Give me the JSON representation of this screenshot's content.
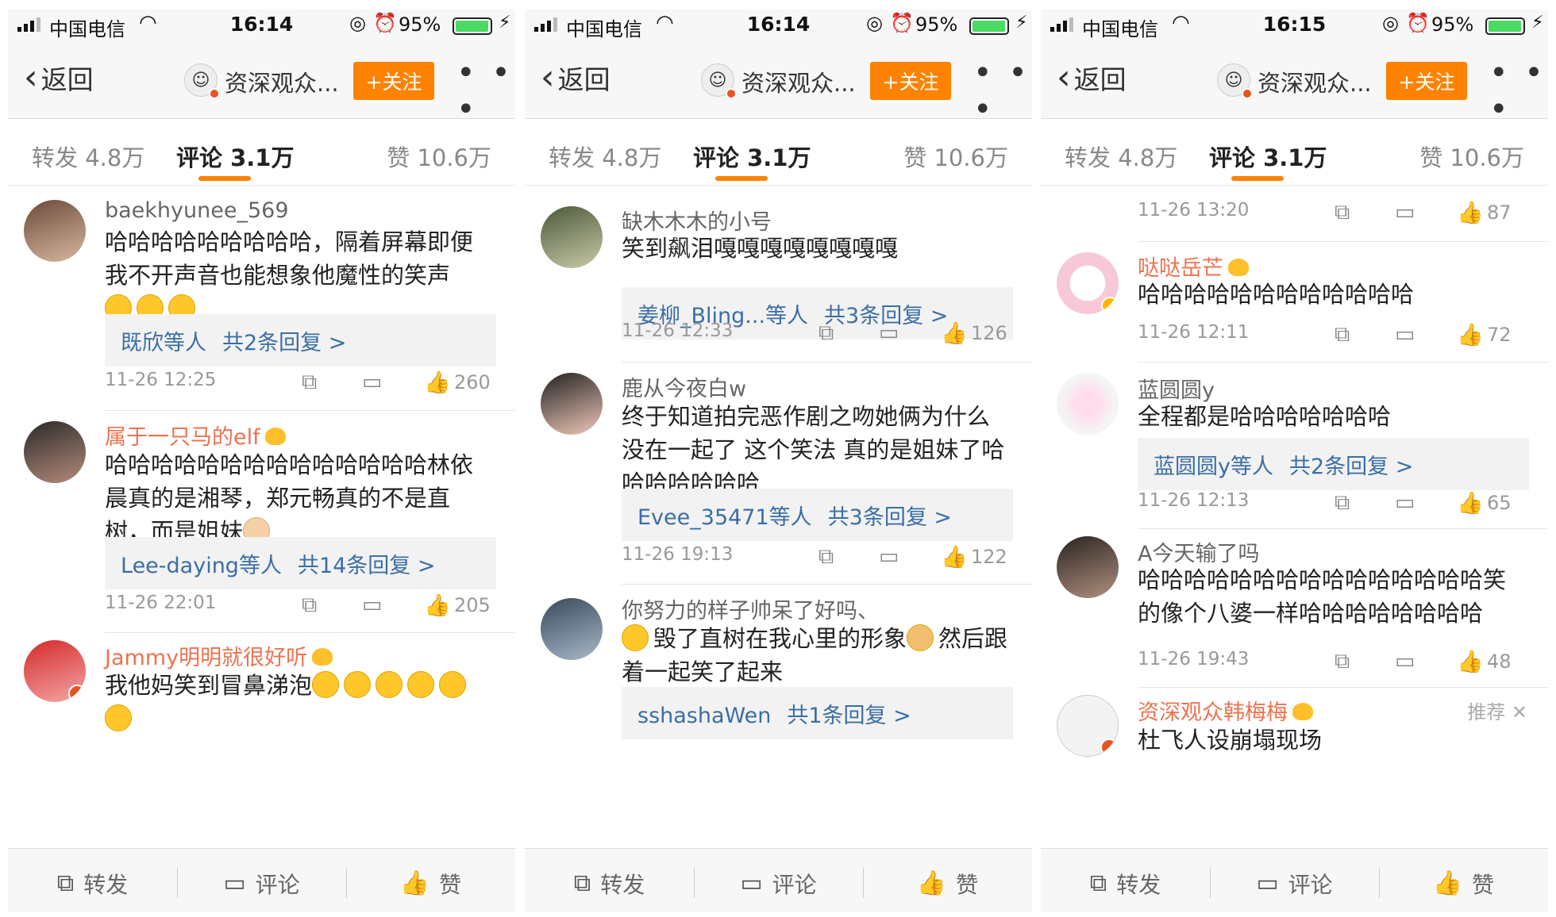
{
  "common": {
    "carrier": "中国电信",
    "battery": "95%",
    "back_label": "返回",
    "account_name": "资深观众...",
    "follow_label": "+关注",
    "more_label": "• • •",
    "tab_repost": "转发 4.8万",
    "tab_comment": "评论 3.1万",
    "tab_like": "赞 10.6万",
    "bottom_repost": "转发",
    "bottom_comment": "评论",
    "bottom_like": "赞",
    "colors": {
      "accent": "#ff8200",
      "link": "#3b6ea5",
      "vip_name": "#eb7350"
    }
  },
  "screens": [
    {
      "time": "16:14",
      "comments": [
        {
          "user": "baekhyunee_569",
          "text": "哈哈哈哈哈哈哈哈哈，隔着屏幕即便我不开声音也能想象他魔性的笑声",
          "reply_users": "既欣等人",
          "reply_count": "共2条回复 >",
          "date": "11-26 12:25",
          "likes": "260"
        },
        {
          "user": "属于一只马的elf",
          "text": "哈哈哈哈哈哈哈哈哈哈哈哈哈哈林依晨真的是湘琴，郑元畅真的不是直树，而是姐妹",
          "reply_users": "Lee-daying等人",
          "reply_count": "共14条回复 >",
          "date": "11-26 22:01",
          "likes": "205"
        },
        {
          "user": "Jammy明明就很好听",
          "text": "我他妈笑到冒鼻涕泡"
        }
      ]
    },
    {
      "time": "16:14",
      "comments": [
        {
          "user": "缺木木木的小号",
          "text": "笑到飙泪嘎嘎嘎嘎嘎嘎嘎嘎",
          "reply_users": "姜柳_Bling...等人",
          "reply_count": "共3条回复 >",
          "date": "11-26 12:33",
          "likes": "126"
        },
        {
          "user": "鹿从今夜白w",
          "text": "终于知道拍完恶作剧之吻她俩为什么没在一起了 这个笑法 真的是姐妹了哈哈哈哈哈哈哈",
          "reply_users": "Evee_35471等人",
          "reply_count": "共3条回复 >",
          "date": "11-26 19:13",
          "likes": "122"
        },
        {
          "user": "你努力的样子帅呆了好吗、",
          "text_a": "毁了直树在我心里的形象",
          "text_b": "然后跟着一起笑了起来",
          "reply_users": "sshashaWen",
          "reply_count": "共1条回复 >"
        }
      ]
    },
    {
      "time": "16:15",
      "comments": [
        {
          "date": "11-26 13:20",
          "likes": "87"
        },
        {
          "user": "哒哒岳芒",
          "text": "哈哈哈哈哈哈哈哈哈哈哈哈",
          "date": "11-26 12:11",
          "likes": "72"
        },
        {
          "user": "蓝圆圆y",
          "text": "全程都是哈哈哈哈哈哈哈",
          "reply_users": "蓝圆圆y等人",
          "reply_count": "共2条回复 >",
          "date": "11-26 12:13",
          "likes": "65"
        },
        {
          "user": "A今天输了吗",
          "text": "哈哈哈哈哈哈哈哈哈哈哈哈哈哈哈笑的像个八婆一样哈哈哈哈哈哈哈哈",
          "date": "11-26 19:43",
          "likes": "48"
        },
        {
          "user": "资深观众韩梅梅",
          "tag": "推荐 ✕",
          "text": "杜飞人设崩塌现场"
        }
      ]
    }
  ]
}
